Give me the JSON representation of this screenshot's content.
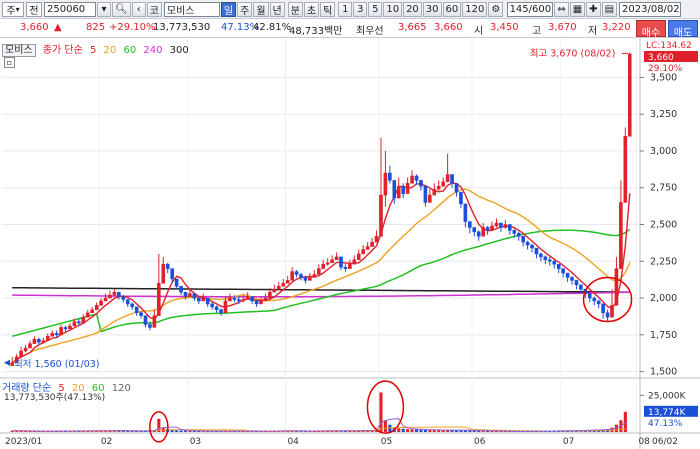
{
  "toolbar": {
    "market_select": "주",
    "market_dropdown": "▾",
    "jeon_label": "전",
    "code": "250060",
    "search_icon": "search-icon",
    "ko_label": "코",
    "name": "모비스",
    "period_tabs": [
      "일",
      "주",
      "월",
      "년"
    ],
    "active_period": "일",
    "minute_labels": [
      "분",
      "초",
      "틱"
    ],
    "intervals": [
      "1",
      "3",
      "5",
      "10",
      "20",
      "30",
      "60",
      "120"
    ],
    "page_counter": "145/600",
    "date": "2023/08/02"
  },
  "info": {
    "price": "3,660",
    "arrow": "▲",
    "change": "825",
    "change_pct": "+29.10%",
    "volume": "13,773,530",
    "vol_ratio": "47.13%",
    "turnover": "42.81%",
    "amount": "48,733백만",
    "best_label": "최우선",
    "ask": "3,665",
    "bid": "3,660",
    "open_label": "시",
    "open": "3,450",
    "high_label": "고",
    "high": "3,670",
    "low_label": "저",
    "low": "3,220",
    "buy_label": "매수",
    "sell_label": "매도"
  },
  "legend": {
    "stock": "모비스",
    "ma_label": "종가 단순",
    "ma_periods": [
      "5",
      "20",
      "60",
      "240",
      "300"
    ]
  },
  "volume_legend": {
    "label": "거래량 단순",
    "ma_periods": [
      "5",
      "20",
      "60",
      "120"
    ],
    "value_text": "13,773,530주(47.13%)"
  },
  "price_axis": {
    "ticks": [
      "3,500",
      "3,250",
      "3,000",
      "2,750",
      "2,500",
      "2,250",
      "2,000",
      "1,750",
      "1,500"
    ],
    "top_badges": [
      "LC:134.62",
      "3,660",
      "29.10%"
    ]
  },
  "volume_axis": {
    "ticks": [
      "25,000K"
    ],
    "badges": [
      "13,774K",
      "47.13%"
    ]
  },
  "annotations": {
    "high": "최고 3,670 (08/02)",
    "low": "최저 1,560 (01/03)"
  },
  "x_axis": {
    "labels": [
      "2023/01",
      "02",
      "03",
      "04",
      "05",
      "06",
      "07",
      "08"
    ],
    "right_label": "06/02"
  },
  "colors": {
    "up": "#e0212b",
    "down": "#1c4fd8",
    "ma5": "#e0212b",
    "ma20": "#f0a020",
    "ma60": "#22c022",
    "ma240": "#d030d0",
    "ma300": "#222222"
  },
  "chart_data": {
    "type": "candlestick",
    "y_range": [
      1470,
      3700
    ],
    "vol_range": [
      0,
      30000
    ],
    "months": [
      "2023/01",
      "02",
      "03",
      "04",
      "05",
      "06",
      "07",
      "08"
    ],
    "closes": [
      1560,
      1600,
      1640,
      1660,
      1690,
      1720,
      1700,
      1710,
      1740,
      1760,
      1750,
      1800,
      1790,
      1810,
      1840,
      1830,
      1870,
      1900,
      1920,
      1950,
      1980,
      2000,
      2020,
      2040,
      2010,
      1990,
      1960,
      1940,
      1900,
      1880,
      1820,
      1800,
      1880,
      2100,
      2230,
      2200,
      2130,
      2080,
      2040,
      2010,
      2030,
      2000,
      1980,
      2000,
      1960,
      1940,
      1920,
      1900,
      1980,
      2000,
      1990,
      1980,
      1990,
      2010,
      1980,
      1960,
      1980,
      2000,
      2040,
      2060,
      2080,
      2100,
      2120,
      2180,
      2160,
      2140,
      2120,
      2140,
      2160,
      2200,
      2230,
      2240,
      2260,
      2280,
      2210,
      2200,
      2230,
      2260,
      2300,
      2330,
      2350,
      2380,
      2420,
      2700,
      2850,
      2800,
      2680,
      2760,
      2710,
      2780,
      2830,
      2800,
      2760,
      2650,
      2700,
      2740,
      2760,
      2790,
      2840,
      2780,
      2720,
      2640,
      2520,
      2480,
      2450,
      2420,
      2480,
      2460,
      2490,
      2510,
      2480,
      2500,
      2460,
      2440,
      2420,
      2380,
      2360,
      2340,
      2300,
      2280,
      2260,
      2250,
      2230,
      2200,
      2170,
      2140,
      2120,
      2090,
      2060,
      2030,
      2000,
      1980,
      1960,
      1900,
      1870,
      1950,
      2200,
      2650,
      3100,
      3660
    ],
    "highs": [
      1600,
      1620,
      1670,
      1680,
      1710,
      1740,
      1730,
      1730,
      1760,
      1780,
      1780,
      1820,
      1810,
      1830,
      1860,
      1860,
      1890,
      1920,
      1940,
      1970,
      2000,
      2030,
      2050,
      2060,
      2040,
      2020,
      1990,
      1970,
      1930,
      1910,
      1860,
      1840,
      1920,
      2300,
      2280,
      2240,
      2170,
      2120,
      2070,
      2040,
      2060,
      2030,
      2010,
      2030,
      1990,
      1970,
      1950,
      1930,
      2010,
      2030,
      2020,
      2010,
      2020,
      2040,
      2010,
      1990,
      2010,
      2030,
      2070,
      2090,
      2110,
      2130,
      2150,
      2210,
      2190,
      2170,
      2150,
      2170,
      2190,
      2230,
      2260,
      2270,
      2290,
      2310,
      2250,
      2230,
      2260,
      2290,
      2330,
      2360,
      2380,
      2410,
      2460,
      3090,
      3000,
      2900,
      2760,
      2820,
      2780,
      2820,
      2870,
      2840,
      2800,
      2700,
      2740,
      2780,
      2800,
      2820,
      2980,
      2820,
      2760,
      2680,
      2560,
      2510,
      2480,
      2460,
      2510,
      2490,
      2520,
      2540,
      2510,
      2530,
      2490,
      2470,
      2450,
      2410,
      2390,
      2370,
      2330,
      2310,
      2290,
      2280,
      2260,
      2230,
      2200,
      2170,
      2150,
      2120,
      2090,
      2060,
      2030,
      2010,
      1990,
      1940,
      1920,
      2060,
      2280,
      2800,
      3160,
      3670
    ],
    "lows": [
      1540,
      1570,
      1610,
      1630,
      1660,
      1690,
      1680,
      1690,
      1720,
      1740,
      1730,
      1780,
      1770,
      1790,
      1820,
      1810,
      1850,
      1880,
      1900,
      1930,
      1960,
      1980,
      2000,
      2020,
      1990,
      1970,
      1940,
      1920,
      1880,
      1860,
      1800,
      1780,
      1860,
      2080,
      2200,
      2170,
      2100,
      2060,
      2020,
      1990,
      2010,
      1980,
      1960,
      1980,
      1940,
      1920,
      1900,
      1880,
      1960,
      1980,
      1970,
      1960,
      1970,
      1990,
      1960,
      1940,
      1960,
      1980,
      2020,
      2040,
      2060,
      2080,
      2100,
      2160,
      2140,
      2120,
      2100,
      2120,
      2140,
      2180,
      2210,
      2220,
      2240,
      2260,
      2190,
      2180,
      2210,
      2240,
      2280,
      2310,
      2330,
      2360,
      2400,
      2680,
      2620,
      2780,
      2640,
      2720,
      2680,
      2750,
      2800,
      2770,
      2730,
      2620,
      2670,
      2710,
      2730,
      2760,
      2800,
      2750,
      2690,
      2610,
      2480,
      2440,
      2420,
      2390,
      2450,
      2430,
      2460,
      2480,
      2450,
      2470,
      2430,
      2410,
      2390,
      2350,
      2330,
      2310,
      2270,
      2250,
      2230,
      2220,
      2200,
      2170,
      2140,
      2110,
      2090,
      2060,
      2030,
      2000,
      1970,
      1950,
      1930,
      1860,
      1840,
      1900,
      2150,
      2560,
      2980,
      3220
    ],
    "volumes": [
      900,
      800,
      700,
      650,
      600,
      700,
      500,
      550,
      600,
      700,
      650,
      800,
      700,
      650,
      800,
      700,
      900,
      850,
      800,
      900,
      950,
      1000,
      1100,
      1200,
      900,
      800,
      700,
      650,
      600,
      700,
      900,
      1000,
      1100,
      9000,
      3000,
      2000,
      1500,
      1200,
      1000,
      900,
      800,
      700,
      650,
      600,
      650,
      600,
      550,
      500,
      700,
      650,
      600,
      550,
      600,
      650,
      600,
      550,
      600,
      650,
      700,
      750,
      800,
      900,
      850,
      800,
      750,
      700,
      650,
      700,
      750,
      800,
      850,
      900,
      950,
      1000,
      900,
      850,
      900,
      950,
      1000,
      1100,
      1200,
      1300,
      1500,
      27000,
      8000,
      5000,
      3000,
      2500,
      2200,
      2000,
      1800,
      1700,
      1600,
      1500,
      1400,
      1300,
      1200,
      1100,
      1500,
      1400,
      1300,
      1200,
      1100,
      1000,
      900,
      850,
      800,
      750,
      700,
      650,
      600,
      550,
      500,
      450,
      400,
      450,
      500,
      550,
      600,
      650,
      700,
      750,
      800,
      850,
      900,
      950,
      1000,
      1100,
      1200,
      1300,
      1400,
      1500,
      1600,
      1700,
      2000,
      3000,
      5000,
      8000,
      13774
    ],
    "ma300_start": 2070,
    "ma240_start": 2020
  }
}
